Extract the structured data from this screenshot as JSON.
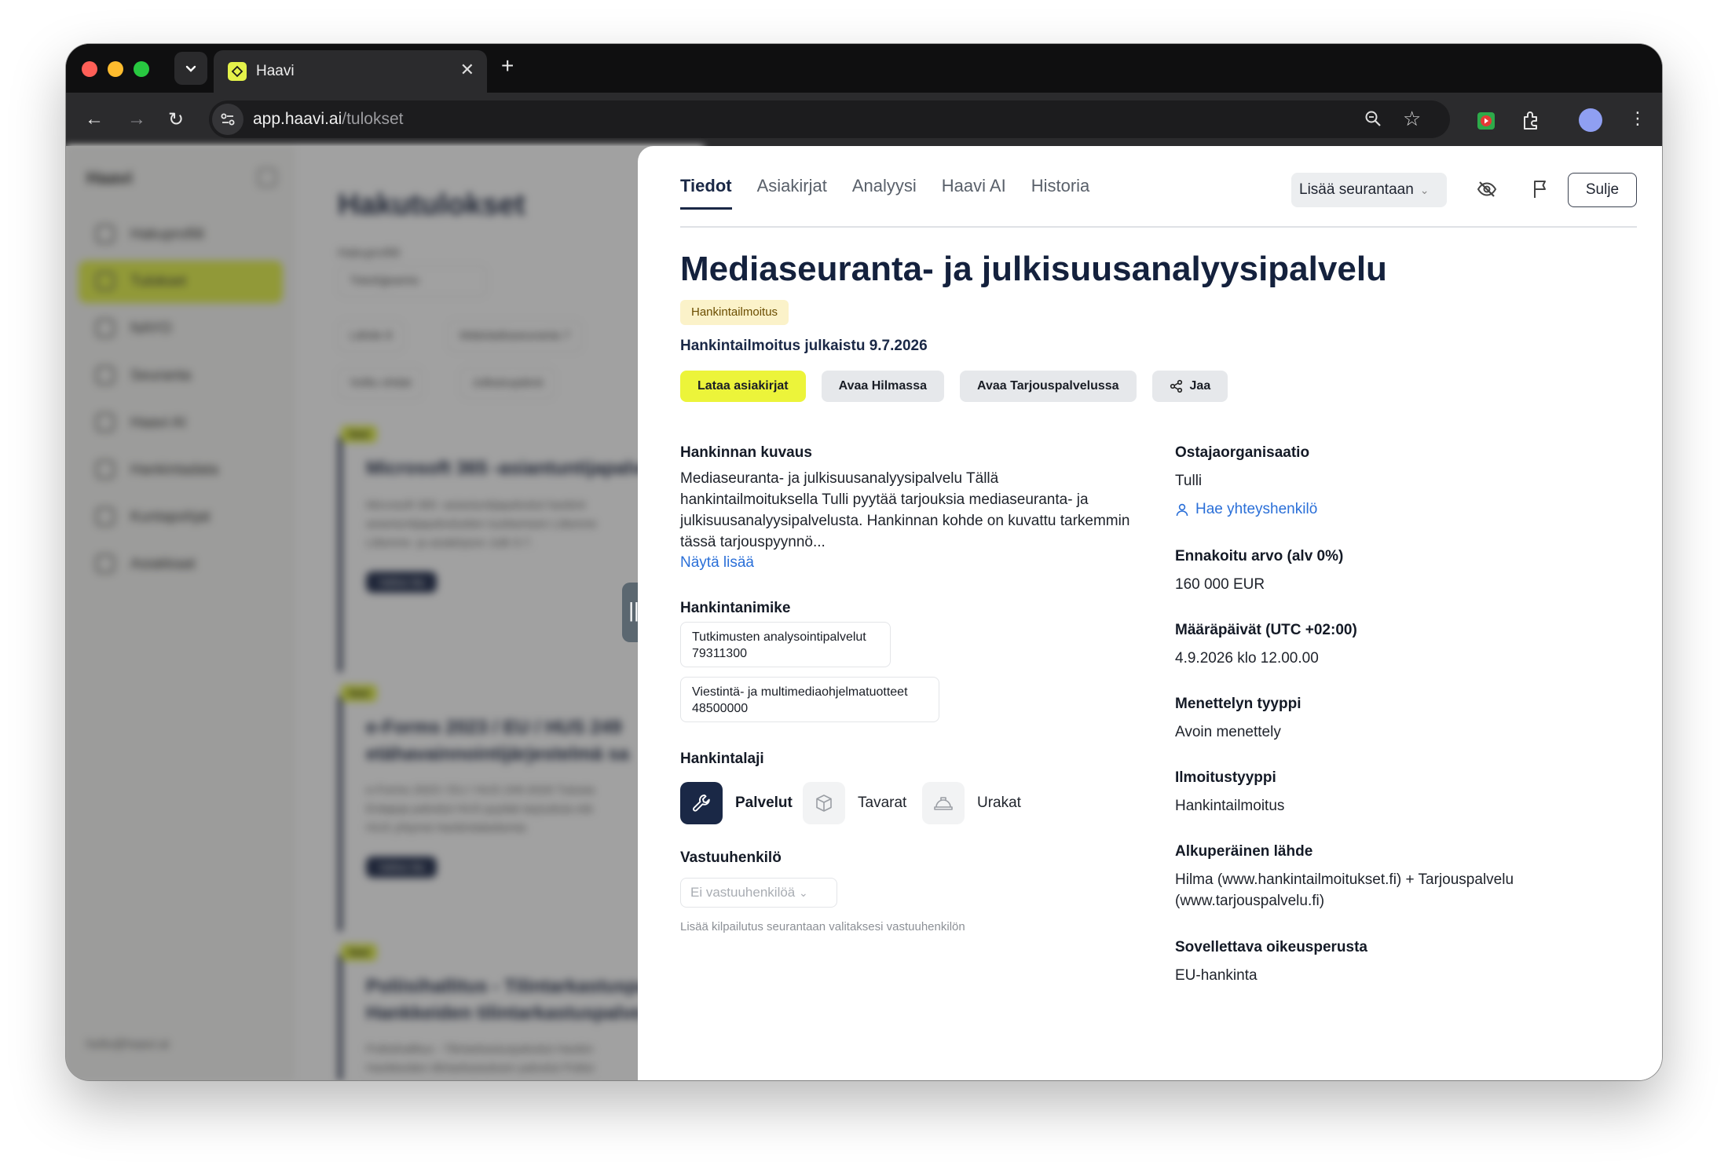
{
  "browser": {
    "tab_title": "Haavi",
    "url_host": "app.haavi.ai",
    "url_path": "/tulokset"
  },
  "background": {
    "brand": "Haavi",
    "sidebar_items": [
      {
        "label": "Hakuprofiili",
        "active": false
      },
      {
        "label": "Tulokset",
        "active": true
      },
      {
        "label": "NAYO",
        "active": false
      },
      {
        "label": "Seuranta",
        "active": false
      },
      {
        "label": "Haavi AI",
        "active": false
      },
      {
        "label": "Hankintadata",
        "active": false
      },
      {
        "label": "Kuntapohjat",
        "active": false
      },
      {
        "label": "Asiakkaat",
        "active": false
      }
    ],
    "sidebar_footer": "hello@haavi.ai",
    "page_title": "Hakutulokset",
    "profile_label": "Hakuprofiili",
    "profile_select": "Tietohjjeamio",
    "filters": [
      "Lähde 8",
      "Määräaikaseuranta 7",
      "Voiltu ohdat",
      "Julkaisupäivä"
    ],
    "cards": [
      {
        "badge": "Uusi",
        "title": "Microsoft 365 -asiantuntijapalve",
        "text": "Microsoft 365 -asiantuntijapalvelut hankint",
        "text2": "asiantuntijapalveluiden tuottamisen Liikenne",
        "text3": "Liikenne- ja asiakirjoon  Julk 9.7.",
        "pill": "Valitse tila"
      },
      {
        "badge": "Uusi",
        "title": "e-Forms 2023 / EU / HUS 249",
        "title2": "etähavainnointijärjestelmä sa",
        "text": "e-Forms 2023 / EU / HUS 249-2026 Tulosta",
        "text2": "Eräajoja palvelut HUS pyytää tarjouksia etä",
        "text3": "HUS yhtymä  Hankintalaskenta",
        "pill": "Valitse tila"
      },
      {
        "badge": "Uusi",
        "title": "Poliisihallitus - Tilintarkastuspal",
        "title2": "Hankkeiden tilintarkastuspalve",
        "text": "Poliisihallitus - Tilintarkastuspalvelut Hankin",
        "text2": "Hankkeiden tilintarkastuksen palvelut Poliisi"
      }
    ]
  },
  "detail": {
    "tabs": [
      {
        "label": "Tiedot",
        "active": true
      },
      {
        "label": "Asiakirjat",
        "active": false
      },
      {
        "label": "Analyysi",
        "active": false
      },
      {
        "label": "Haavi AI",
        "active": false
      },
      {
        "label": "Historia",
        "active": false
      }
    ],
    "track_label": "Lisää seurantaan",
    "close_label": "Sulje",
    "title": "Mediaseuranta- ja julkisuusanalyysipalvelu",
    "notice_badge": "Hankintailmoitus",
    "published": "Hankintailmoitus julkaistu 9.7.2026",
    "actions": {
      "download": "Lataa asiakirjat",
      "hilma": "Avaa Hilmassa",
      "tarjous": "Avaa Tarjouspalvelussa",
      "share": "Jaa"
    },
    "description_label": "Hankinnan kuvaus",
    "description": "Mediaseuranta- ja julkisuusanalyysipalvelu Tällä hankintailmoituksella Tulli pyytää tarjouksia mediaseuranta- ja julkisuusanalyysipalvelusta. Hankinnan kohde on kuvattu tarkemmin tässä tarjouspyynnö...",
    "show_more": "Näytä lisää",
    "cpv_label": "Hankintanimike",
    "cpv": [
      {
        "name": "Tutkimusten analysointipalvelut",
        "code": "79311300"
      },
      {
        "name": "Viestintä- ja multimediaohjelmatuotteet",
        "code": "48500000"
      }
    ],
    "kind_label": "Hankintalaji",
    "kinds": [
      {
        "label": "Palvelut",
        "icon": "wrench-icon",
        "active": true
      },
      {
        "label": "Tavarat",
        "icon": "box-icon",
        "active": false
      },
      {
        "label": "Urakat",
        "icon": "hardhat-icon",
        "active": false
      }
    ],
    "responsible_label": "Vastuuhenkilö",
    "responsible_placeholder": "Ei vastuuhenkilöä",
    "responsible_hint": "Lisää kilpailutus seurantaan valitaksesi vastuuhenkilön",
    "buyer_label": "Ostajaorganisaatio",
    "buyer": "Tulli",
    "contact_link": "Hae yhteyshenkilö",
    "value_label": "Ennakoitu arvo (alv 0%)",
    "value": "160 000 EUR",
    "deadline_label": "Määräpäivät (UTC +02:00)",
    "deadline": "4.9.2026 klo 12.00.00",
    "procedure_label": "Menettelyn tyyppi",
    "procedure": "Avoin menettely",
    "notice_type_label": "Ilmoitustyyppi",
    "notice_type": "Hankintailmoitus",
    "source_label": "Alkuperäinen lähde",
    "source_line1": "Hilma (www.hankintailmoitukset.fi) + Tarjouspalvelu",
    "source_line2": "(www.tarjouspalvelu.fi)",
    "legal_label": "Sovellettava oikeusperusta",
    "legal": "EU-hankinta"
  },
  "colors": {
    "accent_yellow": "#ECF43A",
    "navy": "#1A2846",
    "link_blue": "#2A6FD8"
  }
}
